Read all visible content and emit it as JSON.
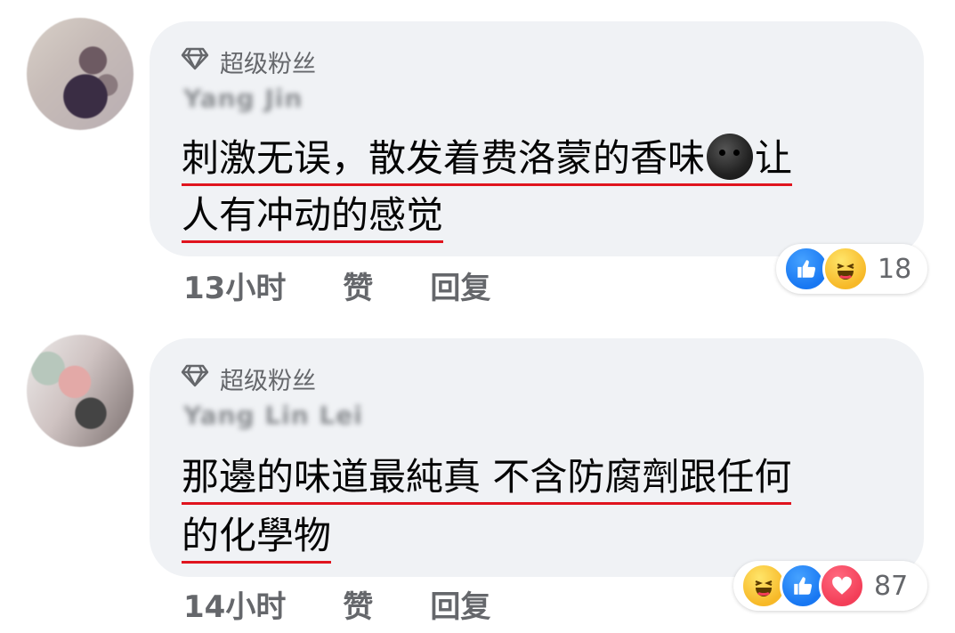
{
  "comments": [
    {
      "badge": "超级粉丝",
      "author": "Yang Jin",
      "line1": "刺激无误，散发着费洛蒙的香味",
      "line1_after": "让",
      "line2": "人有冲动的感觉",
      "time": "13小时",
      "like_label": "赞",
      "reply_label": "回复",
      "reactions": [
        "like",
        "haha"
      ],
      "reaction_count": "18"
    },
    {
      "badge": "超级粉丝",
      "author": "Yang Lin Lei",
      "line1": "那邊的味道最純真 不含防腐劑跟任何",
      "line2": "的化學物",
      "time": "14小时",
      "like_label": "赞",
      "reply_label": "回复",
      "reactions": [
        "haha",
        "like",
        "love"
      ],
      "reaction_count": "87"
    }
  ],
  "colors": {
    "bubble": "#f0f2f5",
    "underline": "#e0141e",
    "meta_text": "#65676b",
    "like": "#1877f2",
    "haha": "#f7b928",
    "love": "#f33e58"
  }
}
